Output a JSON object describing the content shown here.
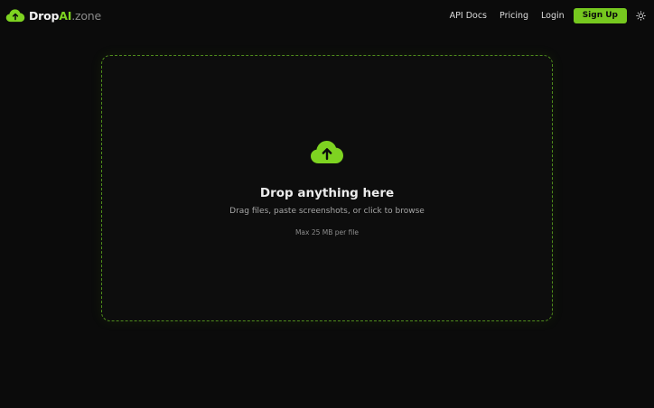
{
  "brand": {
    "name_part1": "Drop",
    "name_part2": "AI",
    "name_part3": ".zone",
    "icon": "cloud-upload-icon"
  },
  "nav": {
    "api_docs": "API Docs",
    "pricing": "Pricing",
    "login": "Login",
    "signup": "Sign Up",
    "theme_icon": "sun-icon"
  },
  "dropzone": {
    "icon": "cloud-upload-icon",
    "title": "Drop anything here",
    "subtitle": "Drag files, paste screenshots, or click to browse",
    "limit": "Max 25 MB per file"
  },
  "colors": {
    "background": "#0b0b0b",
    "accent": "#76c81f",
    "border": "#4f8c1c"
  }
}
